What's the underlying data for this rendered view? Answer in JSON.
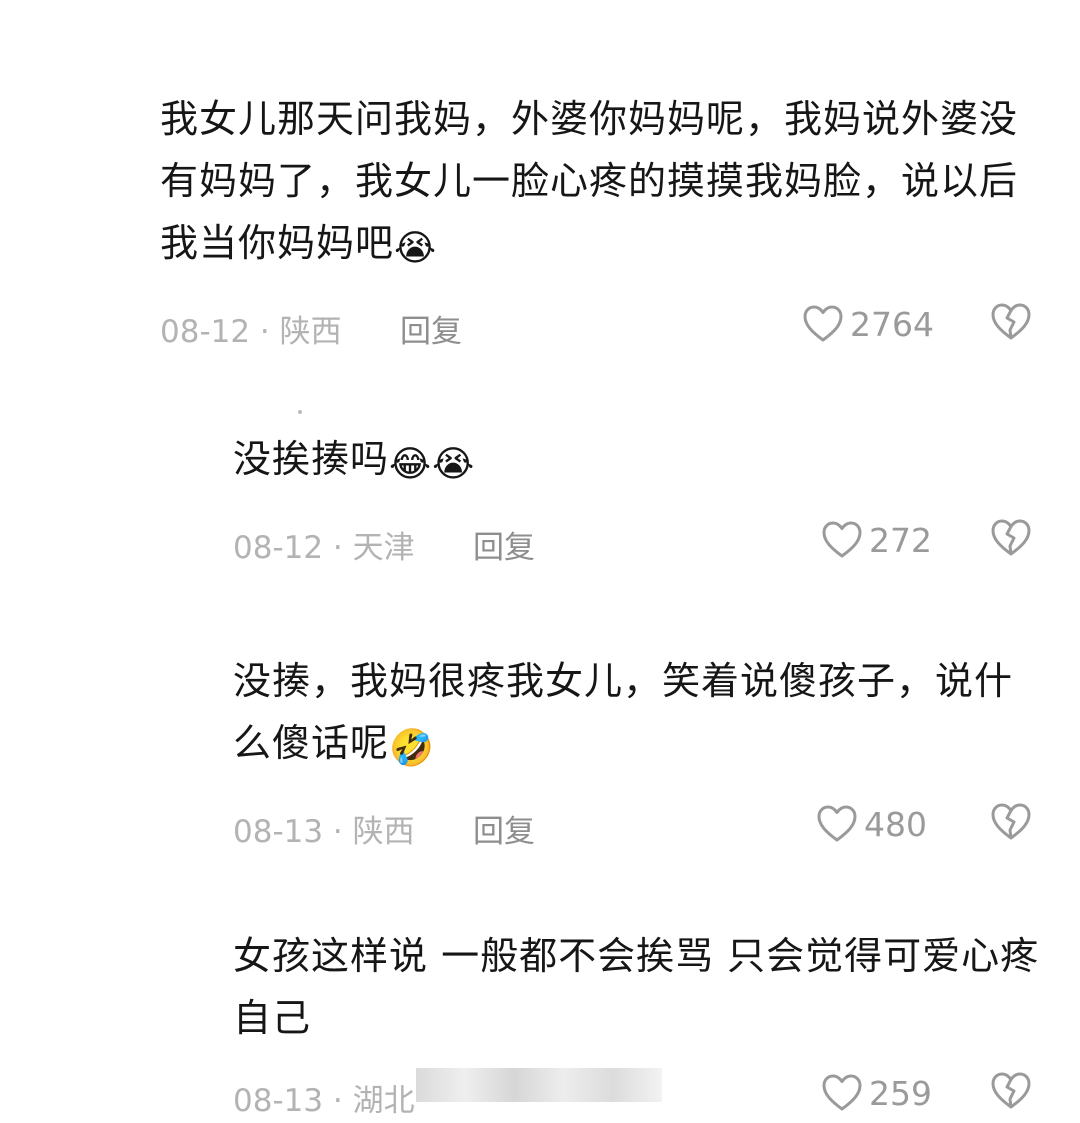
{
  "comments": [
    {
      "text": "我女儿那天问我妈，外婆你妈妈呢，我妈说外婆没有妈妈了，我女儿一脸心疼的摸摸我妈脸，说以后我当你妈妈吧",
      "emojis": "😭",
      "date": "08-12 · 陕西",
      "reply_label": "回复",
      "likes": "2764"
    },
    {
      "text": "没挨揍吗",
      "emojis": "😂😭",
      "date": "08-12 · 天津",
      "reply_label": "回复",
      "likes": "272"
    },
    {
      "text": "没揍，我妈很疼我女儿，笑着说傻孩子，说什么傻话呢",
      "emojis": "🤣",
      "date": "08-13 · 陕西",
      "reply_label": "回复",
      "likes": "480"
    },
    {
      "text": "女孩这样说 一般都不会挨骂 只会觉得可爱心疼自己",
      "emojis": "",
      "date": "08-13 · 湖北",
      "reply_label": "",
      "likes": "259"
    }
  ],
  "icons": {
    "like": "heart-outline-icon",
    "dislike": "broken-heart-icon"
  },
  "colors": {
    "text": "#161616",
    "meta": "#b3b3b3",
    "icon": "#9a9a9a"
  }
}
